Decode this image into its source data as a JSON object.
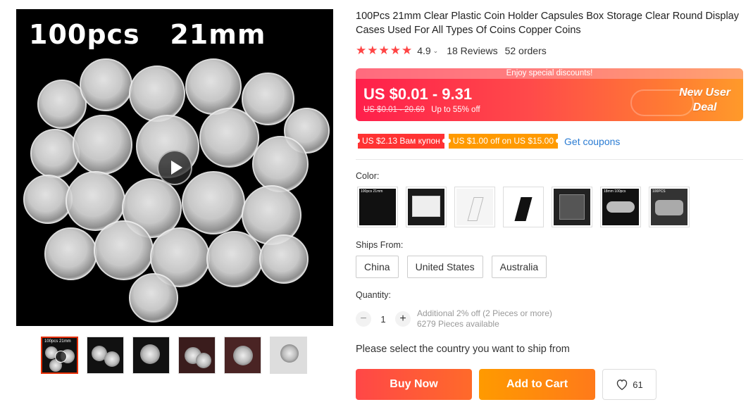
{
  "gallery": {
    "main_overlay": "100pcs   21mm",
    "thumbnails": [
      {
        "label": "100pcs 21mm",
        "active": true
      },
      {
        "label": "",
        "active": false
      },
      {
        "label": "",
        "active": false
      },
      {
        "label": "",
        "active": false
      },
      {
        "label": "",
        "active": false
      },
      {
        "label": "",
        "active": false
      }
    ]
  },
  "product": {
    "title": "100Pcs 21mm Clear Plastic Coin Holder Capsules Box Storage Clear Round Display Cases Used For All Types Of Coins Copper Coins",
    "stars": "★★★★★",
    "rating": "4.9",
    "reviews": "18 Reviews",
    "orders": "52 orders"
  },
  "price": {
    "banner_note": "Enjoy special discounts!",
    "range": "US $0.01 - 9.31",
    "original": "US $0.01 - 20.69",
    "discount": "Up to 55% off",
    "badge_line1": "New User",
    "badge_line2": "Deal",
    "colors": {
      "start": "#ff1f4b",
      "end": "#ff9a2a"
    }
  },
  "coupons": {
    "coupon1": "US $2.13 Вам купон",
    "coupon2": "US $1.00 off on US $15.00",
    "get": "Get coupons"
  },
  "variants": {
    "color_label": "Color:",
    "color_thumbs": [
      "100pcs 21mm",
      "",
      "",
      "",
      "18mm 100pcs",
      "100PCS",
      ""
    ],
    "ships_label": "Ships From:",
    "ships": [
      "China",
      "United States",
      "Australia"
    ]
  },
  "quantity": {
    "label": "Quantity:",
    "minus": "−",
    "value": "1",
    "plus": "+",
    "note1": "Additional 2% off (2 Pieces or more)",
    "note2": "6279 Pieces available"
  },
  "ship_message": "Please select the country you want to ship from",
  "actions": {
    "buy_now": "Buy Now",
    "add_to_cart": "Add to Cart",
    "wishlist_count": "61"
  }
}
